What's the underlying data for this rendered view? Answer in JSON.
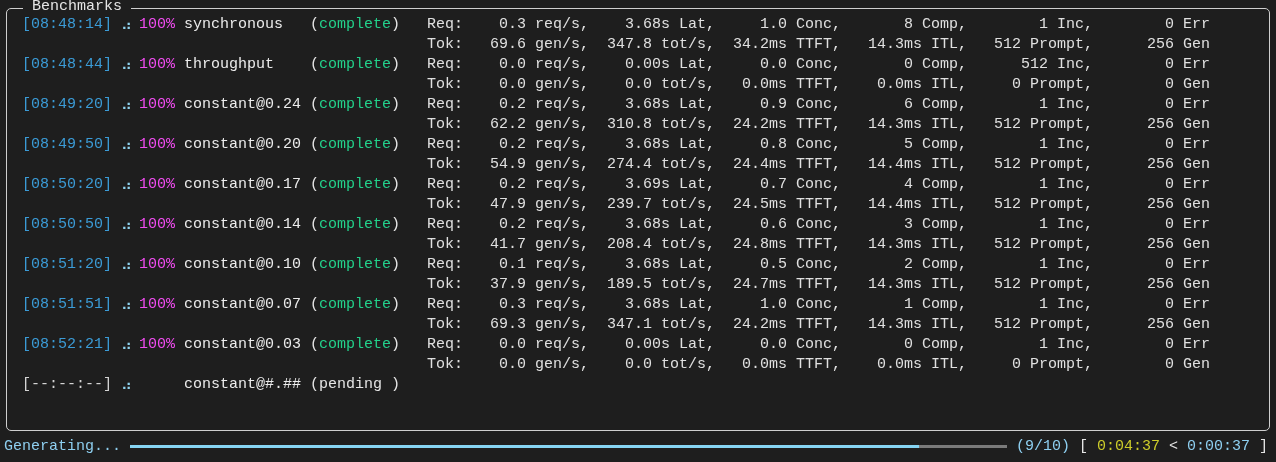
{
  "panel": {
    "title": "Benchmarks"
  },
  "benchmarks": [
    {
      "time": "[08:48:14]",
      "spinner": "⠴",
      "percent": "100%",
      "name": "synchronous",
      "status": "(complete)",
      "done": true,
      "req": [
        "Req:",
        "0.3 req/s,",
        "3.68s Lat,",
        "1.0 Conc,",
        "8 Comp,",
        "1 Inc,",
        "0 Err"
      ],
      "tok": [
        "Tok:",
        "69.6 gen/s,",
        "347.8 tot/s,",
        "34.2ms TTFT,",
        "14.3ms ITL,",
        "512 Prompt,",
        "256 Gen"
      ]
    },
    {
      "time": "[08:48:44]",
      "spinner": "⠴",
      "percent": "100%",
      "name": "throughput",
      "status": "(complete)",
      "done": true,
      "req": [
        "Req:",
        "0.0 req/s,",
        "0.00s Lat,",
        "0.0 Conc,",
        "0 Comp,",
        "512 Inc,",
        "0 Err"
      ],
      "tok": [
        "Tok:",
        "0.0 gen/s,",
        "0.0 tot/s,",
        "0.0ms TTFT,",
        "0.0ms ITL,",
        "0 Prompt,",
        "0 Gen"
      ]
    },
    {
      "time": "[08:49:20]",
      "spinner": "⠴",
      "percent": "100%",
      "name": "constant@0.24",
      "status": "(complete)",
      "done": true,
      "req": [
        "Req:",
        "0.2 req/s,",
        "3.68s Lat,",
        "0.9 Conc,",
        "6 Comp,",
        "1 Inc,",
        "0 Err"
      ],
      "tok": [
        "Tok:",
        "62.2 gen/s,",
        "310.8 tot/s,",
        "24.2ms TTFT,",
        "14.3ms ITL,",
        "512 Prompt,",
        "256 Gen"
      ]
    },
    {
      "time": "[08:49:50]",
      "spinner": "⠴",
      "percent": "100%",
      "name": "constant@0.20",
      "status": "(complete)",
      "done": true,
      "req": [
        "Req:",
        "0.2 req/s,",
        "3.68s Lat,",
        "0.8 Conc,",
        "5 Comp,",
        "1 Inc,",
        "0 Err"
      ],
      "tok": [
        "Tok:",
        "54.9 gen/s,",
        "274.4 tot/s,",
        "24.4ms TTFT,",
        "14.4ms ITL,",
        "512 Prompt,",
        "256 Gen"
      ]
    },
    {
      "time": "[08:50:20]",
      "spinner": "⠴",
      "percent": "100%",
      "name": "constant@0.17",
      "status": "(complete)",
      "done": true,
      "req": [
        "Req:",
        "0.2 req/s,",
        "3.69s Lat,",
        "0.7 Conc,",
        "4 Comp,",
        "1 Inc,",
        "0 Err"
      ],
      "tok": [
        "Tok:",
        "47.9 gen/s,",
        "239.7 tot/s,",
        "24.5ms TTFT,",
        "14.4ms ITL,",
        "512 Prompt,",
        "256 Gen"
      ]
    },
    {
      "time": "[08:50:50]",
      "spinner": "⠴",
      "percent": "100%",
      "name": "constant@0.14",
      "status": "(complete)",
      "done": true,
      "req": [
        "Req:",
        "0.2 req/s,",
        "3.68s Lat,",
        "0.6 Conc,",
        "3 Comp,",
        "1 Inc,",
        "0 Err"
      ],
      "tok": [
        "Tok:",
        "41.7 gen/s,",
        "208.4 tot/s,",
        "24.8ms TTFT,",
        "14.3ms ITL,",
        "512 Prompt,",
        "256 Gen"
      ]
    },
    {
      "time": "[08:51:20]",
      "spinner": "⠴",
      "percent": "100%",
      "name": "constant@0.10",
      "status": "(complete)",
      "done": true,
      "req": [
        "Req:",
        "0.1 req/s,",
        "3.68s Lat,",
        "0.5 Conc,",
        "2 Comp,",
        "1 Inc,",
        "0 Err"
      ],
      "tok": [
        "Tok:",
        "37.9 gen/s,",
        "189.5 tot/s,",
        "24.7ms TTFT,",
        "14.3ms ITL,",
        "512 Prompt,",
        "256 Gen"
      ]
    },
    {
      "time": "[08:51:51]",
      "spinner": "⠴",
      "percent": "100%",
      "name": "constant@0.07",
      "status": "(complete)",
      "done": true,
      "req": [
        "Req:",
        "0.3 req/s,",
        "3.68s Lat,",
        "1.0 Conc,",
        "1 Comp,",
        "1 Inc,",
        "0 Err"
      ],
      "tok": [
        "Tok:",
        "69.3 gen/s,",
        "347.1 tot/s,",
        "24.2ms TTFT,",
        "14.3ms ITL,",
        "512 Prompt,",
        "256 Gen"
      ]
    },
    {
      "time": "[08:52:21]",
      "spinner": "⠴",
      "percent": "100%",
      "name": "constant@0.03",
      "status": "(complete)",
      "done": true,
      "req": [
        "Req:",
        "0.0 req/s,",
        "0.00s Lat,",
        "0.0 Conc,",
        "0 Comp,",
        "1 Inc,",
        "0 Err"
      ],
      "tok": [
        "Tok:",
        "0.0 gen/s,",
        "0.0 tot/s,",
        "0.0ms TTFT,",
        "0.0ms ITL,",
        "0 Prompt,",
        "0 Gen"
      ]
    },
    {
      "time": "[--:--:--]",
      "spinner": "⠴",
      "name": "constant@#.##",
      "status": "(pending )",
      "done": false
    }
  ],
  "status_bar": {
    "label": "Generating...",
    "level": 0.9,
    "count": "(9/10)",
    "open": "[",
    "elapsed": "0:04:37",
    "separator": "<",
    "remaining": "0:00:37",
    "close": "]"
  }
}
